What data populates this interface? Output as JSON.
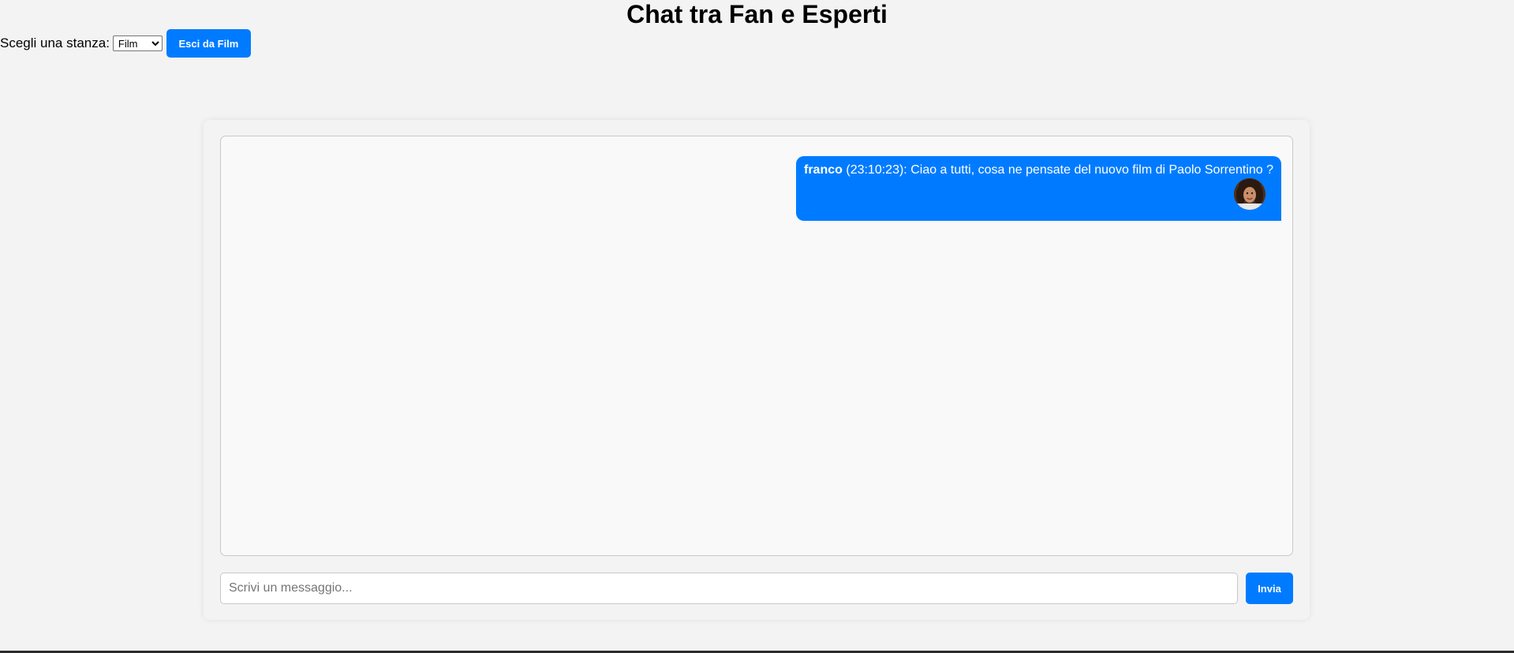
{
  "page": {
    "title": "Chat tra Fan e Esperti"
  },
  "room_bar": {
    "label": "Scegli una stanza:",
    "selected_room": "Film",
    "leave_button_label": "Esci da Film"
  },
  "chat": {
    "messages": [
      {
        "author": "franco",
        "time": "(23:10:23):",
        "text": "Ciao a tutti, cosa ne pensate del nuovo film di Paolo Sorrentino ?",
        "avatar_icon": "user-avatar"
      }
    ]
  },
  "composer": {
    "placeholder": "Scrivi un messaggio...",
    "value": "",
    "send_label": "Invia"
  },
  "colors": {
    "accent": "#007bff",
    "background": "#f3f3f3",
    "message_text": "#ffffff"
  }
}
